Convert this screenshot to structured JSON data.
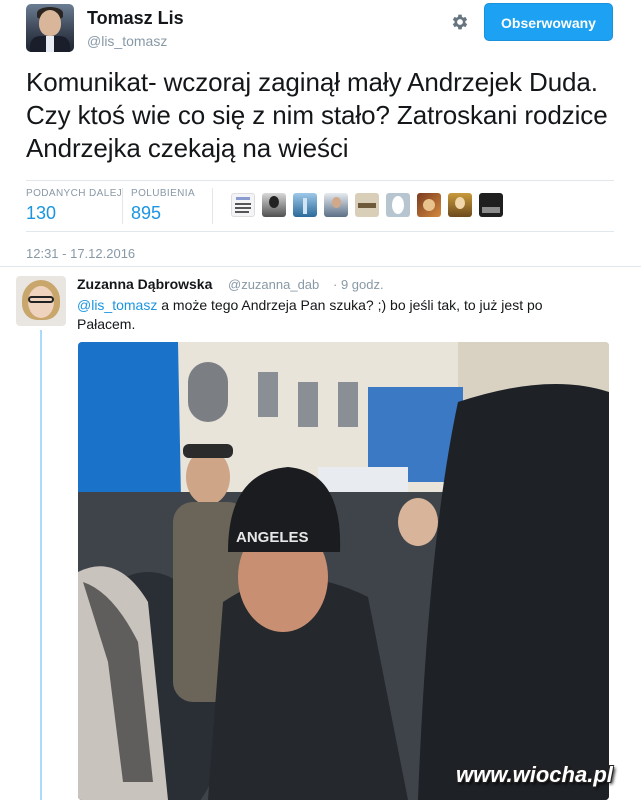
{
  "tweet": {
    "author_name": "Tomasz Lis",
    "author_handle": "@lis_tomasz",
    "follow_label": "Obserwowany",
    "text": "Komunikat- wczoraj zaginął mały Andrzejek Duda. Czy ktoś wie co się z nim stało? Zatroskani rodzice Andrzejka czekają na wieści",
    "stats": {
      "retweets_label": "PODANYCH DALEJ",
      "retweets_value": "130",
      "likes_label": "POLUBIENIA",
      "likes_value": "895"
    },
    "timestamp": "12:31 - 17.12.2016",
    "liker_avatars": [
      "liker-1",
      "liker-2",
      "liker-3",
      "liker-4",
      "liker-5",
      "liker-6",
      "liker-7",
      "liker-8",
      "liker-9"
    ]
  },
  "reply": {
    "author_name": "Zuzanna Dąbrowska",
    "author_handle": "@zuzanna_dab",
    "time": "· 9 godz.",
    "mention": "@lis_tomasz",
    "text": " a może tego Andrzeja Pan szuka? ;) bo jeśli tak, to już jest po Pałacem.",
    "photo_hat_text": "ANGELES"
  },
  "watermark": "www.wiocha.pl",
  "colors": {
    "accent": "#1da1f2",
    "link": "#1b95e0",
    "muted": "#8899a6",
    "thread": "#a8dcfa"
  },
  "icons": {
    "settings": "gear-icon"
  }
}
